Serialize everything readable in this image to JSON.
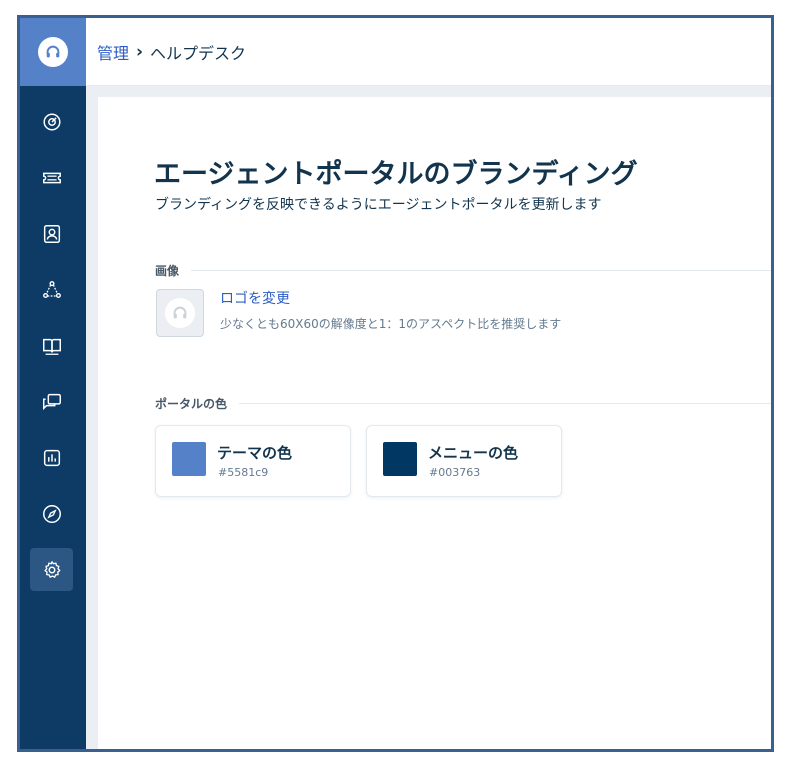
{
  "breadcrumb": {
    "parent": "管理",
    "separator": "›",
    "current": "ヘルプデスク"
  },
  "sidebar": {
    "logo_icon": "headset-icon",
    "brand_color": "#5581c9",
    "background_color": "#0d3b66",
    "items": [
      {
        "icon": "dashboard-icon",
        "active": false
      },
      {
        "icon": "ticket-icon",
        "active": false
      },
      {
        "icon": "contacts-icon",
        "active": false
      },
      {
        "icon": "groups-icon",
        "active": false
      },
      {
        "icon": "knowledge-base-icon",
        "active": false
      },
      {
        "icon": "forums-icon",
        "active": false
      },
      {
        "icon": "reports-icon",
        "active": false
      },
      {
        "icon": "compass-icon",
        "active": false
      },
      {
        "icon": "settings-icon",
        "active": true
      }
    ]
  },
  "page": {
    "title": "エージェントポータルのブランディング",
    "subtitle": "ブランディングを反映できるようにエージェントポータルを更新します"
  },
  "image_section": {
    "heading": "画像",
    "change_logo_label": "ロゴを変更",
    "hint": "少なくとも60X60の解像度と1：1のアスペクト比を推奨します"
  },
  "colors_section": {
    "heading": "ポータルの色",
    "theme": {
      "label": "テーマの色",
      "hex": "#5581c9"
    },
    "menu": {
      "label": "メニューの色",
      "hex": "#003763"
    }
  }
}
